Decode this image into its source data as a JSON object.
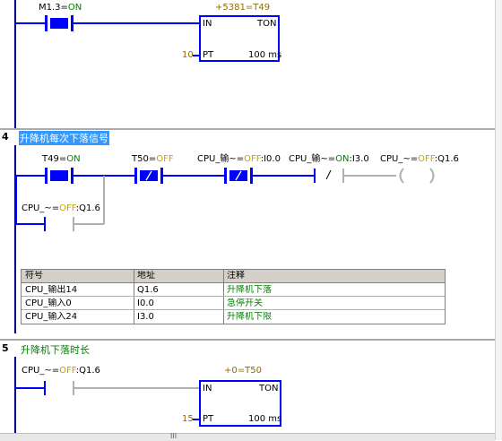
{
  "networks": [
    {
      "contact_m13": {
        "name": "M1.3",
        "state": "ON"
      },
      "timer_t49": {
        "value": "+5381",
        "name": "T49",
        "in": "IN",
        "type": "TON",
        "pt_value": "10",
        "pt": "PT",
        "unit": "100 ms"
      }
    },
    {
      "number": "4",
      "title": "升降机每次下落信号",
      "c_t49": {
        "name": "T49",
        "state": "ON"
      },
      "c_t50": {
        "name": "T50",
        "state": "OFF"
      },
      "c_i00": {
        "prefix": "CPU_输~",
        "state": "OFF",
        "addr": ":I0.0"
      },
      "c_i30": {
        "prefix": "CPU_输~",
        "state": "ON",
        "addr": ":I3.0"
      },
      "coil_q16": {
        "prefix": "CPU_~",
        "state": "OFF",
        "addr": ":Q1.6"
      },
      "branch_q16": {
        "prefix": "CPU_~",
        "state": "OFF",
        "addr": ":Q1.6"
      },
      "symbol_table": {
        "headers": [
          "符号",
          "地址",
          "注释"
        ],
        "rows": [
          [
            "CPU_输出14",
            "Q1.6",
            " 升降机下落"
          ],
          [
            "CPU_输入0",
            "I0.0",
            "急停开关"
          ],
          [
            "CPU_输入24",
            "I3.0",
            "升降机下限"
          ]
        ]
      }
    },
    {
      "number": "5",
      "title": "升降机下落时长",
      "c_q16": {
        "prefix": "CPU_~",
        "state": "OFF",
        "addr": ":Q1.6"
      },
      "timer_t50": {
        "value": "+0",
        "name": "T50",
        "in": "IN",
        "type": "TON",
        "pt_value": "15",
        "pt": "PT",
        "unit": "100 ms"
      }
    }
  ],
  "scrollbar_grip": "III",
  "colors": {
    "rail": "#00008b",
    "active": "#0000ff",
    "inactive": "#b0b0b0",
    "on": "#008000",
    "off": "#c8a000",
    "highlight": "#3399ff"
  }
}
